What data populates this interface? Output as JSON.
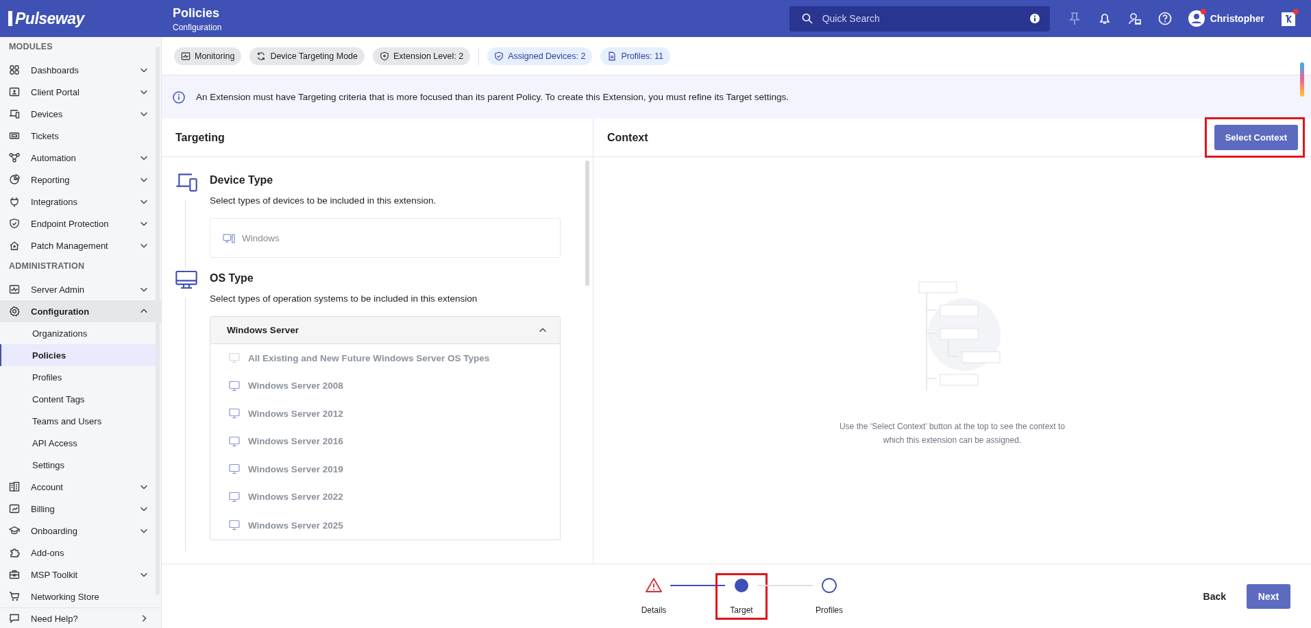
{
  "header": {
    "logo": "Pulseway",
    "title": "Policies",
    "subtitle": "Configuration",
    "search": {
      "placeholder": "Quick Search"
    },
    "user": {
      "name": "Christopher",
      "notification": true
    },
    "app": {
      "notification": true
    }
  },
  "sidebar": {
    "items": [
      {
        "kind": "section",
        "label": "MODULES"
      },
      {
        "kind": "item",
        "label": "Dashboards",
        "expanded": false,
        "selected": false
      },
      {
        "kind": "item",
        "label": "Client Portal",
        "expanded": false,
        "selected": false
      },
      {
        "kind": "item",
        "label": "Devices",
        "expanded": false,
        "selected": false
      },
      {
        "kind": "item",
        "label": "Tickets",
        "selected": false
      },
      {
        "kind": "item",
        "label": "Automation",
        "expanded": false,
        "selected": false
      },
      {
        "kind": "item",
        "label": "Reporting",
        "expanded": false,
        "selected": false
      },
      {
        "kind": "item",
        "label": "Integrations",
        "expanded": false,
        "selected": false
      },
      {
        "kind": "item",
        "label": "Endpoint Protection",
        "expanded": false,
        "selected": false
      },
      {
        "kind": "item",
        "label": "Patch Management",
        "expanded": false,
        "selected": false
      },
      {
        "kind": "section",
        "label": "ADMINISTRATION"
      },
      {
        "kind": "item",
        "label": "Server Admin",
        "expanded": false,
        "selected": false
      },
      {
        "kind": "item",
        "label": "Configuration",
        "expanded": true,
        "selected": true
      },
      {
        "kind": "subitem",
        "label": "Organizations",
        "selected": false
      },
      {
        "kind": "subitem",
        "label": "Policies",
        "selected": true
      },
      {
        "kind": "subitem",
        "label": "Profiles",
        "selected": false
      },
      {
        "kind": "subitem",
        "label": "Content Tags",
        "selected": false
      },
      {
        "kind": "subitem",
        "label": "Teams and Users",
        "selected": false
      },
      {
        "kind": "subitem",
        "label": "API Access",
        "selected": false
      },
      {
        "kind": "subitem",
        "label": "Settings",
        "selected": false
      },
      {
        "kind": "item",
        "label": "Account",
        "expanded": false,
        "selected": false
      },
      {
        "kind": "item",
        "label": "Billing",
        "expanded": false,
        "selected": false
      },
      {
        "kind": "item",
        "label": "Onboarding",
        "expanded": false,
        "selected": false
      },
      {
        "kind": "item",
        "label": "Add-ons",
        "selected": false
      },
      {
        "kind": "item",
        "label": "MSP Toolkit",
        "expanded": false,
        "selected": false
      },
      {
        "kind": "item",
        "label": "Networking Store",
        "selected": false
      }
    ],
    "footer": {
      "label": "Need Help?"
    }
  },
  "chips": [
    {
      "kind": "neutral",
      "label": "Monitoring"
    },
    {
      "kind": "neutral",
      "label": "Device Targeting Mode"
    },
    {
      "kind": "neutral",
      "label": "Extension Level: 2"
    },
    {
      "kind": "info",
      "label": "Assigned Devices: 2"
    },
    {
      "kind": "info",
      "label": "Profiles: 11"
    }
  ],
  "banner": "An Extension must have Targeting criteria that is more focused than its parent Policy. To create this Extension, you must refine its Target settings.",
  "targeting": {
    "title": "Targeting",
    "sections": [
      {
        "title": "Device Type",
        "description": "Select types of devices to be included in this extension.",
        "options": [
          {
            "label": "Windows"
          }
        ]
      },
      {
        "title": "OS Type",
        "description": "Select types of operation systems to be included in this extension",
        "group": {
          "title": "Windows Server",
          "expanded": true,
          "items": [
            {
              "label": "All Existing and New Future Windows Server OS Types",
              "kind": "all"
            },
            {
              "label": "Windows Server 2008",
              "kind": "version"
            },
            {
              "label": "Windows Server 2012",
              "kind": "version"
            },
            {
              "label": "Windows Server 2016",
              "kind": "version"
            },
            {
              "label": "Windows Server 2019",
              "kind": "version"
            },
            {
              "label": "Windows Server 2022",
              "kind": "version"
            },
            {
              "label": "Windows Server 2025",
              "kind": "version"
            }
          ]
        }
      }
    ]
  },
  "context": {
    "title": "Context",
    "button": {
      "label": "Select Context",
      "highlighted": true
    },
    "empty_message": "Use the ‘Select Context’ button at the top to see the context to which this extension can be assigned."
  },
  "stepper": {
    "steps": [
      {
        "label": "Details",
        "kind": "warning",
        "highlighted": false
      },
      {
        "label": "Target",
        "kind": "current",
        "highlighted": true
      },
      {
        "label": "Profiles",
        "kind": "pending",
        "highlighted": false
      }
    ]
  },
  "footer_buttons": {
    "back": "Back",
    "next": "Next"
  }
}
